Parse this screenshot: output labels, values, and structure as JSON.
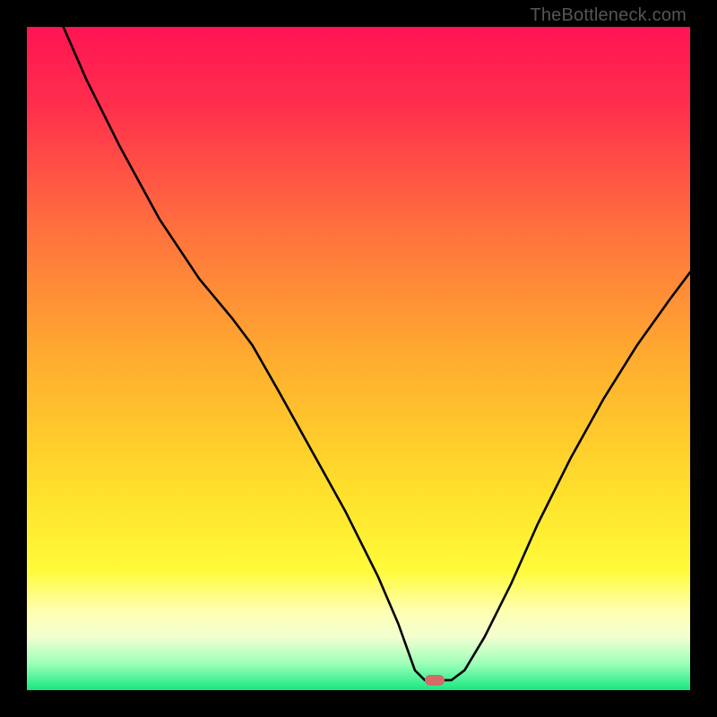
{
  "watermark": "TheBottleneck.com",
  "colors": {
    "gradient_stops": [
      {
        "offset": 0.0,
        "color": "#ff1452"
      },
      {
        "offset": 0.12,
        "color": "#ff2f4d"
      },
      {
        "offset": 0.3,
        "color": "#ff6f3e"
      },
      {
        "offset": 0.5,
        "color": "#ffac2f"
      },
      {
        "offset": 0.7,
        "color": "#ffe02b"
      },
      {
        "offset": 0.82,
        "color": "#fffb3a"
      },
      {
        "offset": 0.88,
        "color": "#ffffb0"
      },
      {
        "offset": 0.92,
        "color": "#f3ffd0"
      },
      {
        "offset": 0.96,
        "color": "#9dffb9"
      },
      {
        "offset": 1.0,
        "color": "#17e880"
      }
    ],
    "curve": "#000000",
    "marker": "#d46a6a",
    "frame": "#000000"
  },
  "marker": {
    "x_frac": 0.615,
    "y_frac": 0.985
  },
  "chart_data": {
    "type": "line",
    "title": "",
    "xlabel": "",
    "ylabel": "",
    "xlim": [
      0,
      1
    ],
    "ylim": [
      0,
      1
    ],
    "note": "x is normalized position across plot width; y is normalized bottleneck level (1 = top/red, 0 = bottom/green). Values estimated from pixels.",
    "series": [
      {
        "name": "bottleneck-curve",
        "x": [
          0.055,
          0.09,
          0.14,
          0.2,
          0.26,
          0.31,
          0.34,
          0.38,
          0.43,
          0.48,
          0.53,
          0.56,
          0.585,
          0.6,
          0.64,
          0.66,
          0.69,
          0.73,
          0.77,
          0.82,
          0.87,
          0.92,
          0.97,
          1.0
        ],
        "y": [
          1.0,
          0.92,
          0.82,
          0.71,
          0.62,
          0.56,
          0.52,
          0.45,
          0.36,
          0.27,
          0.17,
          0.1,
          0.03,
          0.015,
          0.015,
          0.03,
          0.08,
          0.16,
          0.25,
          0.35,
          0.44,
          0.52,
          0.59,
          0.63
        ]
      }
    ],
    "optimum": {
      "x": 0.615,
      "y": 0.015
    }
  }
}
